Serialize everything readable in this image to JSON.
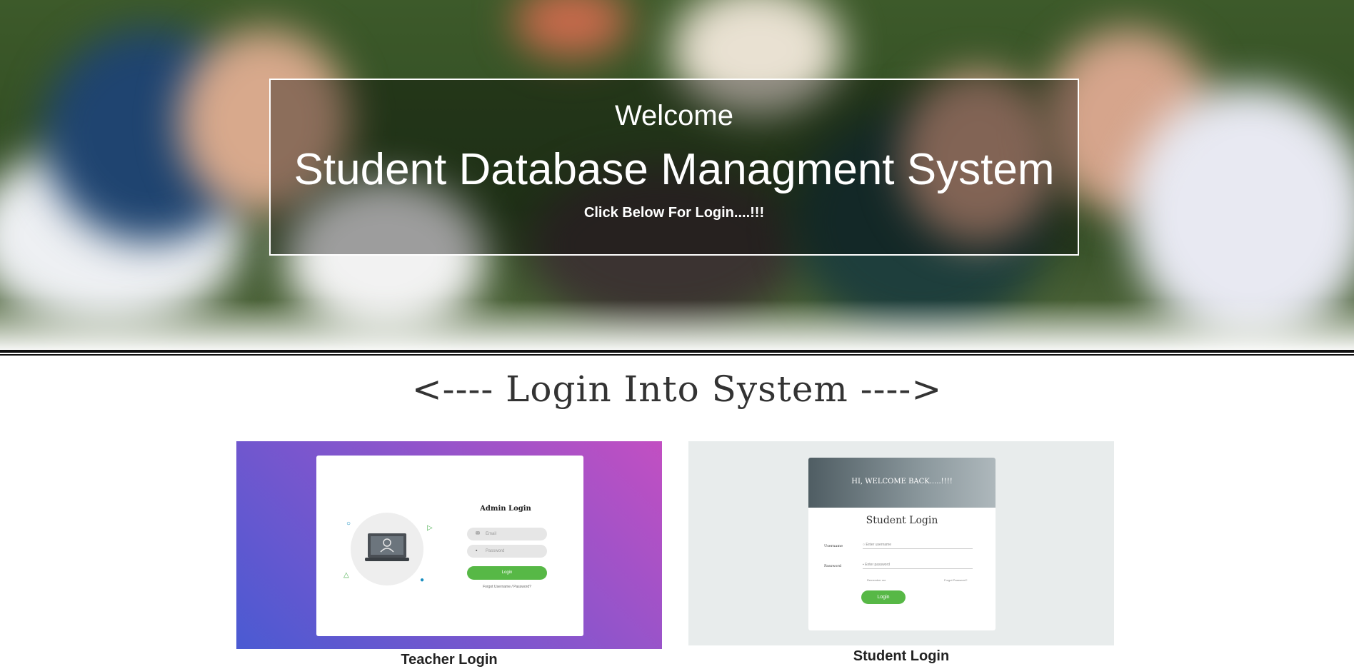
{
  "hero": {
    "welcome": "Welcome",
    "title": "Student Database Managment System",
    "subtitle": "Click Below For Login....!!!"
  },
  "section": {
    "heading": "<---- Login Into System ---->"
  },
  "teacher": {
    "label": "Teacher Login",
    "preview": {
      "title": "Admin Login",
      "email_placeholder": "Email",
      "password_placeholder": "Password",
      "login_button": "Login",
      "forgot_text": "Forgot Username / Password?"
    }
  },
  "student": {
    "label": "Student Login",
    "preview": {
      "banner": "HI, WELCOME BACK.....!!!!",
      "title": "Student Login",
      "username_label": "Username",
      "username_placeholder": "Enter username",
      "password_label": "Password",
      "password_placeholder": "Enter password",
      "remember_me": "Remember me",
      "forgot_password": "Forgot Password?",
      "login_button": "Login"
    }
  },
  "colors": {
    "login_button": "#57b846",
    "teacher_gradient_start": "#4a5ad2",
    "teacher_gradient_end": "#c24fc2",
    "student_card_bg": "#e8ecec"
  },
  "icons": {
    "email": "envelope-icon",
    "password": "lock-icon",
    "user": "user-icon"
  }
}
